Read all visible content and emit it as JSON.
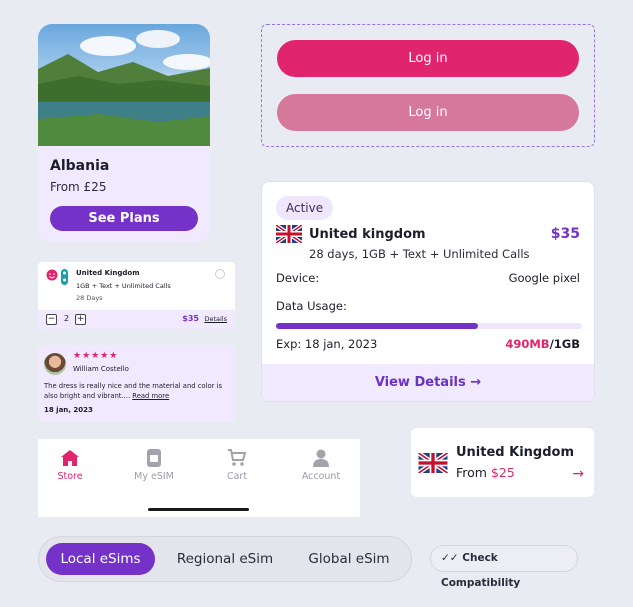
{
  "colors": {
    "brand_purple": "#7432c8",
    "brand_pink": "#e1246e",
    "pink_muted": "#d6779c",
    "lavender": "#f1e9fd"
  },
  "albania_card": {
    "country": "Albania",
    "price": "From £25",
    "button": "See Plans"
  },
  "login": {
    "primary_label": "Log in",
    "secondary_label": "Log in"
  },
  "plan_card": {
    "status": "Active",
    "country": "United kingdom",
    "price": "$35",
    "description": "28 days, 1GB + Text + Unlimited Calls",
    "device_label": "Device:",
    "device_value": "Google pixel",
    "usage_label": "Data Usage:",
    "usage_fraction": 0.66,
    "expiry": "Exp: 18 jan, 2023",
    "data_used": "490MB",
    "data_total": "/1GB",
    "footer": "View Details",
    "flag_icon": "uk-flag-icon"
  },
  "mini_plan": {
    "country": "United Kingdom",
    "description": "1GB + Text + Unlimited Calls",
    "days": "28 Days",
    "quantity": "2",
    "minus": "−",
    "plus": "+",
    "price": "$35",
    "details": "Details"
  },
  "review": {
    "stars": "★★★★★",
    "rating": 5,
    "name": "William Costello",
    "text": "The dress is really nice and the material and color is also bright and vibrant....",
    "read_more": "Read more",
    "date": "18 jan, 2023"
  },
  "nav": {
    "items": [
      {
        "label": "Store",
        "icon": "store-icon",
        "active": true
      },
      {
        "label": "My eSIM",
        "icon": "esim-icon",
        "active": false
      },
      {
        "label": "Cart",
        "icon": "cart-icon",
        "active": false
      },
      {
        "label": "Account",
        "icon": "account-icon",
        "active": false
      }
    ]
  },
  "uk_card": {
    "country": "United Kingdom",
    "from": "From",
    "price": "$25"
  },
  "tabs": {
    "items": [
      "Local eSims",
      "Regional eSim",
      "Global eSim"
    ],
    "active": 0
  },
  "compat": {
    "label": "Check Compatibility"
  }
}
